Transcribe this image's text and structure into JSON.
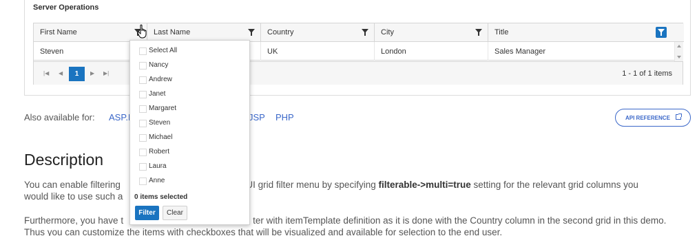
{
  "panel": {
    "title": "Server Operations"
  },
  "grid": {
    "columns": [
      {
        "label": "First Name"
      },
      {
        "label": "Last Name"
      },
      {
        "label": "Country"
      },
      {
        "label": "City"
      },
      {
        "label": "Title"
      }
    ],
    "rows": [
      {
        "first_name": "Steven",
        "last_name": "",
        "country": "UK",
        "city": "London",
        "title": "Sales Manager"
      }
    ],
    "pager": {
      "current_page": "1",
      "info": "1 - 1 of 1 items"
    }
  },
  "filter_menu": {
    "items": [
      "Select All",
      "Nancy",
      "Andrew",
      "Janet",
      "Margaret",
      "Steven",
      "Michael",
      "Robert",
      "Laura",
      "Anne"
    ],
    "selected_count": "0 items selected",
    "filter_label": "Filter",
    "clear_label": "Clear"
  },
  "also_available": {
    "label": "Also available for:",
    "links": [
      "ASP.N",
      "JSP",
      "PHP"
    ],
    "api_button": "API REFERENCE"
  },
  "description": {
    "heading": "Description",
    "p1_a": "You can enable filtering ",
    "p1_b": "do UI grid filter menu by specifying ",
    "p1_bold": "filterable->multi=true",
    "p1_c": " setting for the relevant grid columns you",
    "p1_line2": "would like to use such a",
    "p2_a": "Furthermore, you have t",
    "p2_b": "ter with itemTemplate definition as it is done with the Country column in the second grid in this demo.",
    "p2_line2": "Thus you can customize the items with checkboxes that will be visualized and available for selection to the end user."
  },
  "colors": {
    "accent": "#1a74c0",
    "link": "#3a67c9"
  }
}
